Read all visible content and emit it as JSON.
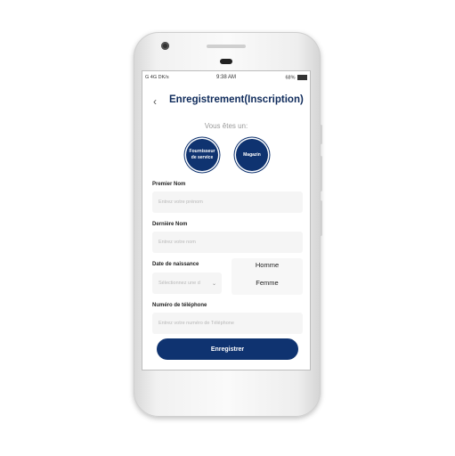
{
  "statusbar": {
    "left": "G 4G DK/s",
    "time": "9:38 AM",
    "battery": "68%"
  },
  "header": {
    "title": "Enregistrement(Inscription)"
  },
  "form": {
    "subtitle": "Vous êtes un:",
    "type_options": [
      "Fournisseur de service",
      "Magazin"
    ],
    "first_name": {
      "label": "Premier Nom",
      "placeholder": "Entrez votre prénom"
    },
    "last_name": {
      "label": "Dernière Nom",
      "placeholder": "Entrez votre nom"
    },
    "birth_date": {
      "label": "Date de naissance",
      "placeholder": "Sélectionnez une d"
    },
    "gender_options": [
      "Homme",
      "Femme"
    ],
    "phone": {
      "label": "Numéro de téléphone",
      "placeholder": "Entrez votre numéro de Téléphone"
    },
    "submit_label": "Enregistrer"
  },
  "colors": {
    "primary": "#0f3370",
    "title": "#0f2b5b"
  },
  "icons": {
    "back": "chevron-left-icon",
    "dropdown": "chevron-down-icon"
  }
}
